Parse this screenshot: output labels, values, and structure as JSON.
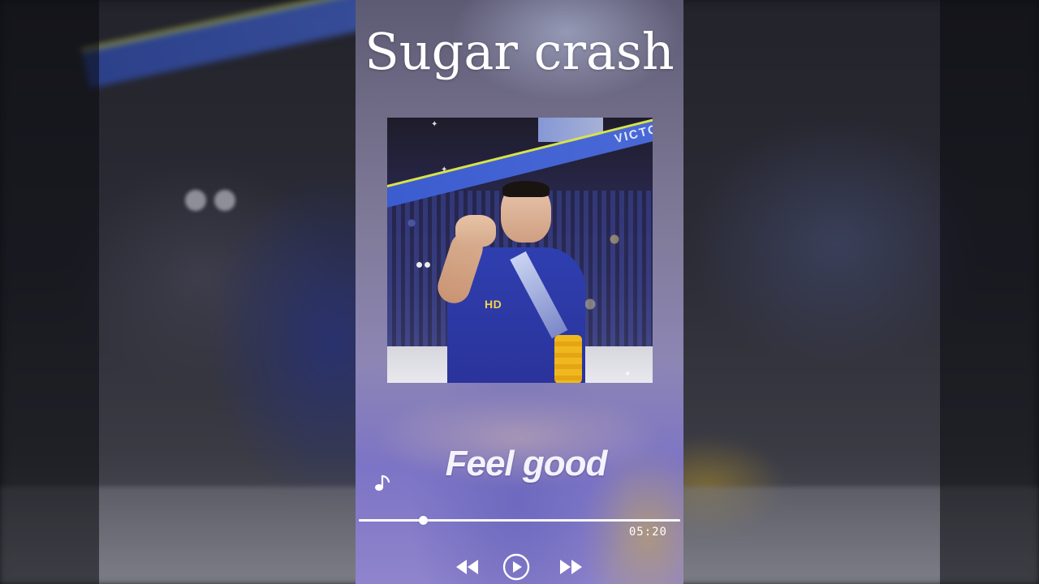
{
  "player": {
    "song_title": "Sugar crash",
    "track_name": "Feel good",
    "total_time": "05:20",
    "progress": 0.2
  },
  "album_art": {
    "banner_text": "VICTO",
    "jersey_logo": "HD"
  },
  "icons": {
    "note": "music-note-icon",
    "rewind": "rewind-icon",
    "play": "play-circle-icon",
    "forward": "fast-forward-icon"
  },
  "colors": {
    "panel_accent": "#8d86b4",
    "text": "#ffffff"
  }
}
